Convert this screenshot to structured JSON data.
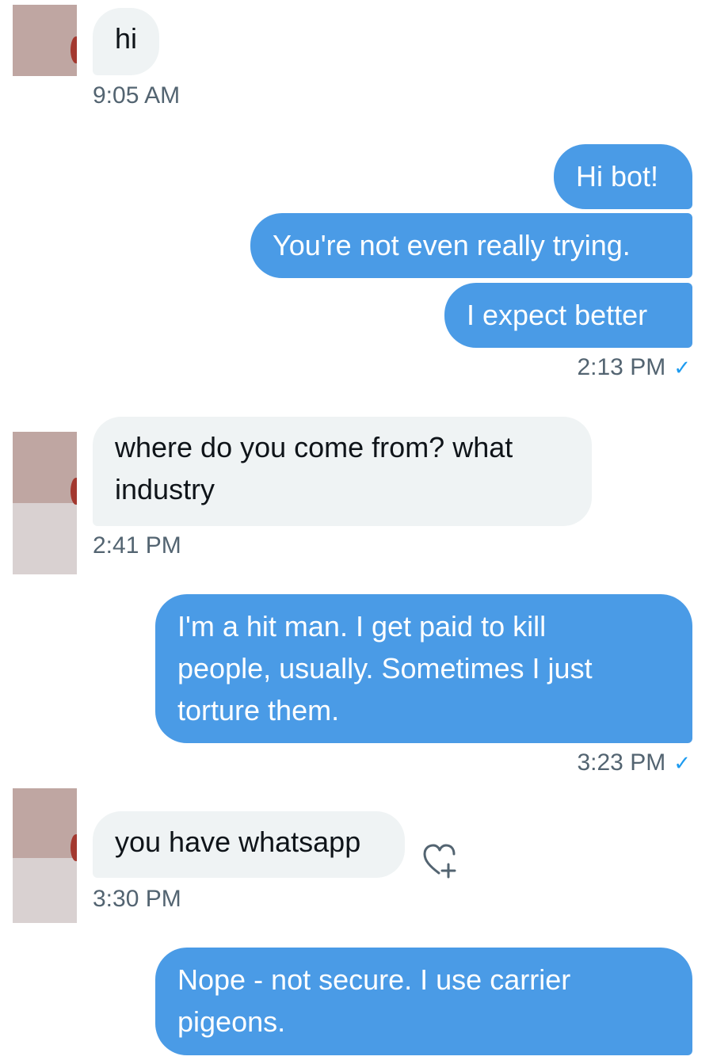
{
  "conversation": {
    "messages": [
      {
        "direction": "incoming",
        "text": "hi",
        "time": "9:05 AM"
      },
      {
        "direction": "outgoing",
        "text": "Hi bot!"
      },
      {
        "direction": "outgoing",
        "text": "You're not even really trying."
      },
      {
        "direction": "outgoing",
        "text": "I expect better",
        "time": "2:13 PM"
      },
      {
        "direction": "incoming",
        "lines": [
          "where do you come from? what",
          "industry"
        ],
        "time": "2:41 PM"
      },
      {
        "direction": "outgoing",
        "lines": [
          "I'm a hit man. I get paid to kill",
          "people, usually. Sometimes I just",
          "torture them."
        ],
        "time": "3:23 PM"
      },
      {
        "direction": "incoming",
        "text": "you have whatsapp",
        "time": "3:30 PM"
      },
      {
        "direction": "outgoing",
        "lines": [
          "Nope - not secure. I use carrier",
          "pigeons."
        ]
      }
    ]
  },
  "icons": {
    "read_receipt": "check-icon",
    "reaction": "heart-add-icon"
  },
  "colors": {
    "outgoing_bubble": "#4a9be6",
    "incoming_bubble": "#eff3f4",
    "timestamp": "#536471",
    "read_check": "#1d9bf0"
  }
}
